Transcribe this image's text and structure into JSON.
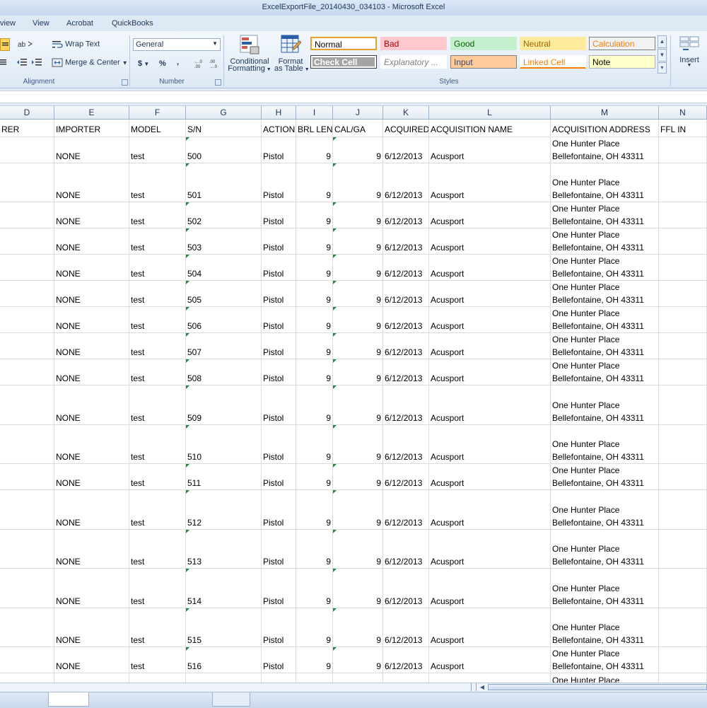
{
  "window": {
    "title": "ExcelExportFile_20140430_034103  -  Microsoft Excel"
  },
  "menu_tabs": [
    "view",
    "View",
    "Acrobat",
    "QuickBooks"
  ],
  "ribbon": {
    "alignment": {
      "wrap_text": "Wrap Text",
      "merge_center": "Merge & Center",
      "label": "Alignment"
    },
    "number": {
      "format_value": "General",
      "currency": "$",
      "percent": "%",
      "comma": ",",
      "label": "Number"
    },
    "styles": {
      "conditional": "Conditional",
      "conditional2": "Formatting",
      "format": "Format",
      "format2": "as Table",
      "label": "Styles",
      "gallery": [
        {
          "name": "Normal",
          "bg": "#ffffff",
          "fg": "#000000",
          "border": "#e8a028"
        },
        {
          "name": "Bad",
          "bg": "#ffc7ce",
          "fg": "#9c0006",
          "border": "#ffc7ce"
        },
        {
          "name": "Good",
          "bg": "#c6efce",
          "fg": "#006100",
          "border": "#c6efce"
        },
        {
          "name": "Neutral",
          "bg": "#ffeb9c",
          "fg": "#9c6500",
          "border": "#ffeb9c"
        },
        {
          "name": "Calculation",
          "bg": "#f2f2f2",
          "fg": "#fa7d00",
          "border": "#7f7f7f"
        },
        {
          "name": "Check Cell",
          "bg": "#a5a5a5",
          "fg": "#ffffff",
          "border": "#3f3f3f"
        },
        {
          "name": "Explanatory ...",
          "bg": "#ffffff",
          "fg": "#7f7f7f",
          "border": "#ffffff"
        },
        {
          "name": "Input",
          "bg": "#ffcc99",
          "fg": "#3f3f76",
          "border": "#7f7f7f"
        },
        {
          "name": "Linked Cell",
          "bg": "#ffffff",
          "fg": "#fa7d00",
          "border": "#ffffff"
        },
        {
          "name": "Note",
          "bg": "#ffffcc",
          "fg": "#000000",
          "border": "#b2b2b2"
        }
      ]
    },
    "cells": {
      "insert": "Insert"
    }
  },
  "columns": {
    "letters": [
      "D",
      "E",
      "F",
      "G",
      "H",
      "I",
      "J",
      "K",
      "L",
      "M",
      "N"
    ],
    "headers": [
      "RER",
      "IMPORTER",
      "MODEL",
      "S/N",
      "ACTION",
      "BRL LEN",
      "CAL/GA",
      "ACQUIRED",
      "ACQUISITION NAME",
      "ACQUISITION ADDRESS",
      "FFL IN"
    ]
  },
  "rows": [
    {
      "importer": "NONE",
      "model": "test",
      "sn": "500",
      "action": "Pistol",
      "brl": "9",
      "cal": "9",
      "acquired": "6/12/2013",
      "name": "Acusport",
      "addr1": "One Hunter Place",
      "addr2": "Bellefontaine, OH 43311"
    },
    {
      "importer": "NONE",
      "model": "test",
      "sn": "501",
      "action": "Pistol",
      "brl": "9",
      "cal": "9",
      "acquired": "6/12/2013",
      "name": "Acusport",
      "addr1": "One Hunter Place",
      "addr2": "Bellefontaine, OH 43311"
    },
    {
      "importer": "NONE",
      "model": "test",
      "sn": "502",
      "action": "Pistol",
      "brl": "9",
      "cal": "9",
      "acquired": "6/12/2013",
      "name": "Acusport",
      "addr1": "One Hunter Place",
      "addr2": "Bellefontaine, OH 43311"
    },
    {
      "importer": "NONE",
      "model": "test",
      "sn": "503",
      "action": "Pistol",
      "brl": "9",
      "cal": "9",
      "acquired": "6/12/2013",
      "name": "Acusport",
      "addr1": "One Hunter Place",
      "addr2": "Bellefontaine, OH 43311"
    },
    {
      "importer": "NONE",
      "model": "test",
      "sn": "504",
      "action": "Pistol",
      "brl": "9",
      "cal": "9",
      "acquired": "6/12/2013",
      "name": "Acusport",
      "addr1": "One Hunter Place",
      "addr2": "Bellefontaine, OH 43311"
    },
    {
      "importer": "NONE",
      "model": "test",
      "sn": "505",
      "action": "Pistol",
      "brl": "9",
      "cal": "9",
      "acquired": "6/12/2013",
      "name": "Acusport",
      "addr1": "One Hunter Place",
      "addr2": "Bellefontaine, OH 43311"
    },
    {
      "importer": "NONE",
      "model": "test",
      "sn": "506",
      "action": "Pistol",
      "brl": "9",
      "cal": "9",
      "acquired": "6/12/2013",
      "name": "Acusport",
      "addr1": "One Hunter Place",
      "addr2": "Bellefontaine, OH 43311"
    },
    {
      "importer": "NONE",
      "model": "test",
      "sn": "507",
      "action": "Pistol",
      "brl": "9",
      "cal": "9",
      "acquired": "6/12/2013",
      "name": "Acusport",
      "addr1": "One Hunter Place",
      "addr2": "Bellefontaine, OH 43311"
    },
    {
      "importer": "NONE",
      "model": "test",
      "sn": "508",
      "action": "Pistol",
      "brl": "9",
      "cal": "9",
      "acquired": "6/12/2013",
      "name": "Acusport",
      "addr1": "One Hunter Place",
      "addr2": "Bellefontaine, OH 43311"
    },
    {
      "importer": "NONE",
      "model": "test",
      "sn": "509",
      "action": "Pistol",
      "brl": "9",
      "cal": "9",
      "acquired": "6/12/2013",
      "name": "Acusport",
      "addr1": "One Hunter Place",
      "addr2": "Bellefontaine, OH 43311"
    },
    {
      "importer": "NONE",
      "model": "test",
      "sn": "510",
      "action": "Pistol",
      "brl": "9",
      "cal": "9",
      "acquired": "6/12/2013",
      "name": "Acusport",
      "addr1": "One Hunter Place",
      "addr2": "Bellefontaine, OH 43311"
    },
    {
      "importer": "NONE",
      "model": "test",
      "sn": "511",
      "action": "Pistol",
      "brl": "9",
      "cal": "9",
      "acquired": "6/12/2013",
      "name": "Acusport",
      "addr1": "One Hunter Place",
      "addr2": "Bellefontaine, OH 43311"
    },
    {
      "importer": "NONE",
      "model": "test",
      "sn": "512",
      "action": "Pistol",
      "brl": "9",
      "cal": "9",
      "acquired": "6/12/2013",
      "name": "Acusport",
      "addr1": "One Hunter Place",
      "addr2": "Bellefontaine, OH 43311"
    },
    {
      "importer": "NONE",
      "model": "test",
      "sn": "513",
      "action": "Pistol",
      "brl": "9",
      "cal": "9",
      "acquired": "6/12/2013",
      "name": "Acusport",
      "addr1": "One Hunter Place",
      "addr2": "Bellefontaine, OH 43311"
    },
    {
      "importer": "NONE",
      "model": "test",
      "sn": "514",
      "action": "Pistol",
      "brl": "9",
      "cal": "9",
      "acquired": "6/12/2013",
      "name": "Acusport",
      "addr1": "One Hunter Place",
      "addr2": "Bellefontaine, OH 43311"
    },
    {
      "importer": "NONE",
      "model": "test",
      "sn": "515",
      "action": "Pistol",
      "brl": "9",
      "cal": "9",
      "acquired": "6/12/2013",
      "name": "Acusport",
      "addr1": "One Hunter Place",
      "addr2": "Bellefontaine, OH 43311"
    },
    {
      "importer": "NONE",
      "model": "test",
      "sn": "516",
      "action": "Pistol",
      "brl": "9",
      "cal": "9",
      "acquired": "6/12/2013",
      "name": "Acusport",
      "addr1": "One Hunter Place",
      "addr2": "Bellefontaine, OH 43311"
    },
    {
      "importer": "",
      "model": "",
      "sn": "",
      "action": "",
      "brl": "",
      "cal": "",
      "acquired": "",
      "name": "",
      "addr1": "One Hunter Place",
      "addr2": ""
    }
  ]
}
